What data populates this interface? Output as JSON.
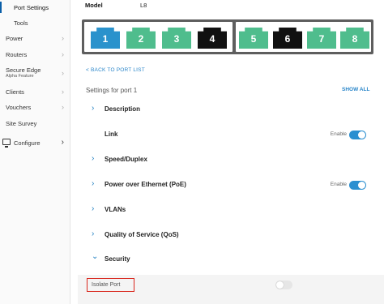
{
  "sidebar": {
    "items": [
      {
        "label": "Port Settings",
        "active": true
      },
      {
        "label": "Tools"
      },
      {
        "label": "Power"
      },
      {
        "label": "Routers"
      },
      {
        "label": "Secure Edge",
        "sub": "Alpha Feature"
      },
      {
        "label": "Clients"
      },
      {
        "label": "Vouchers"
      },
      {
        "label": "Site Survey"
      }
    ],
    "configure": {
      "label": "Configure",
      "icon": "monitor-icon"
    }
  },
  "model": {
    "label": "Model",
    "value": "L8"
  },
  "ports": [
    {
      "number": "1",
      "color": "#2a92cc",
      "state": "selected"
    },
    {
      "number": "2",
      "color": "#4fbd8d",
      "state": "up"
    },
    {
      "number": "3",
      "color": "#4fbd8d",
      "state": "up"
    },
    {
      "number": "4",
      "color": "#111111",
      "state": "down"
    },
    {
      "number": "5",
      "color": "#4fbd8d",
      "state": "up"
    },
    {
      "number": "6",
      "color": "#111111",
      "state": "down"
    },
    {
      "number": "7",
      "color": "#4fbd8d",
      "state": "up"
    },
    {
      "number": "8",
      "color": "#4fbd8d",
      "state": "up"
    }
  ],
  "back_link": "< BACK TO PORT LIST",
  "settings_title": "Settings for port 1",
  "show_all": "SHOW ALL",
  "sections": [
    {
      "title": "Description",
      "arrow": "›"
    },
    {
      "title": "Link",
      "enable_label": "Enable",
      "enabled": true
    },
    {
      "title": "Speed/Duplex",
      "arrow": "›"
    },
    {
      "title": "Power over Ethernet (PoE)",
      "arrow": "›",
      "enable_label": "Enable",
      "enabled": true
    },
    {
      "title": "VLANs",
      "arrow": "›"
    },
    {
      "title": "Quality of Service (QoS)",
      "arrow": "›"
    },
    {
      "title": "Security",
      "arrow": "⌄"
    }
  ],
  "security": {
    "isolate_label": "Isolate Port",
    "isolate_enabled": false
  },
  "colors": {
    "accent": "#2a8fd0",
    "highlight_box": "#d9261c"
  }
}
